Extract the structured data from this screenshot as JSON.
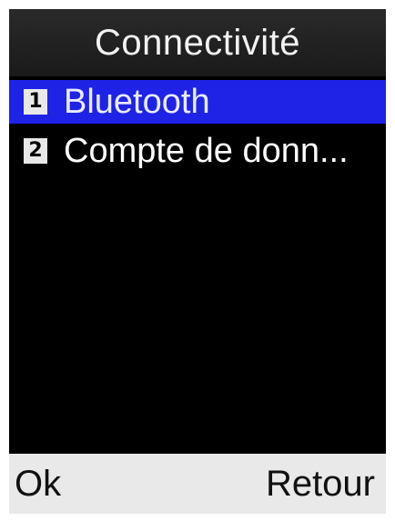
{
  "header": {
    "title": "Connectivité"
  },
  "menu": {
    "items": [
      {
        "number": "1",
        "label": "Bluetooth",
        "selected": true
      },
      {
        "number": "2",
        "label": "Compte de donn...",
        "selected": false
      }
    ]
  },
  "softkeys": {
    "left": "Ok",
    "right": "Retour"
  },
  "colors": {
    "screen_background": "#000000",
    "selection_highlight": "#1f23e6",
    "softkey_bar": "#e9e9e9",
    "text_primary": "#ffffff"
  }
}
